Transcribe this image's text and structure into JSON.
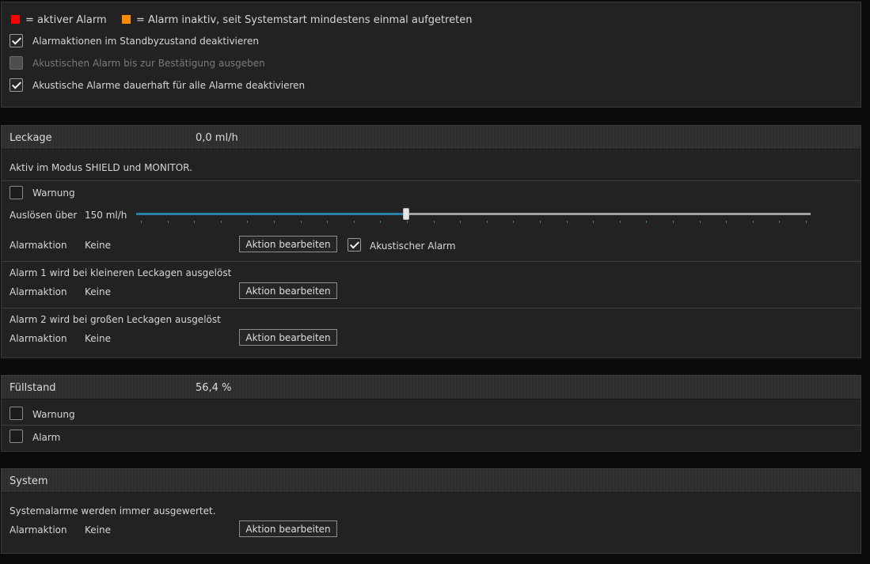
{
  "legend": {
    "active": {
      "label": "= aktiver Alarm",
      "color": "#ff0000"
    },
    "inactive": {
      "label": "= Alarm inaktiv, seit Systemstart mindestens einmal aufgetreten",
      "color": "#ff8c00"
    }
  },
  "global_options": [
    {
      "label": "Alarmaktionen im Standbyzustand deaktivieren",
      "checked": true,
      "enabled": true
    },
    {
      "label": "Akustischen Alarm bis zur Bestätigung ausgeben",
      "checked": false,
      "enabled": false
    },
    {
      "label": "Akustische Alarme dauerhaft für alle Alarme deaktivieren",
      "checked": true,
      "enabled": true
    }
  ],
  "leckage": {
    "title": "Leckage",
    "value": "0,0 ml/h",
    "info": "Aktiv im Modus SHIELD und MONITOR.",
    "warning_label": "Warnung",
    "trigger_label": "Auslösen über",
    "trigger_value": "150 ml/h",
    "slider_fraction": 0.4,
    "alarm_action_label": "Alarmaktion",
    "alarm_action_value": "Keine",
    "edit_button": "Aktion bearbeiten",
    "acoustic_label": "Akustischer Alarm",
    "alarm1_desc": "Alarm 1 wird bei kleineren Leckagen ausgelöst",
    "alarm2_desc": "Alarm 2 wird bei großen Leckagen ausgelöst"
  },
  "fuellstand": {
    "title": "Füllstand",
    "value": "56,4 %",
    "warning_label": "Warnung",
    "alarm_label": "Alarm"
  },
  "system": {
    "title": "System",
    "info": "Systemalarme werden immer ausgewertet.",
    "alarm_action_label": "Alarmaktion",
    "alarm_action_value": "Keine",
    "edit_button": "Aktion bearbeiten"
  }
}
